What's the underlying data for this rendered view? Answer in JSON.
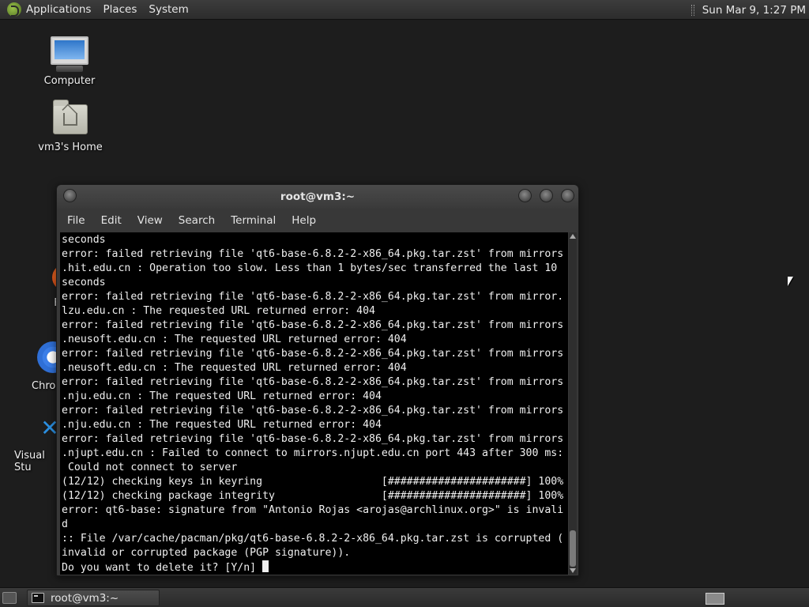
{
  "top_panel": {
    "menus": [
      "Applications",
      "Places",
      "System"
    ],
    "clock": "Sun Mar  9,  1:27 PM"
  },
  "desktop_icons": [
    {
      "label": "Computer",
      "icon": "computer-icon"
    },
    {
      "label": "vm3's Home",
      "icon": "home-folder-icon"
    },
    {
      "label": "F",
      "icon": "firefox-icon"
    },
    {
      "label": "Chron",
      "icon": "chromium-icon"
    },
    {
      "label": "Visual Stu",
      "icon": "vscode-icon"
    }
  ],
  "window": {
    "title": "root@vm3:~",
    "menu": [
      "File",
      "Edit",
      "View",
      "Search",
      "Terminal",
      "Help"
    ]
  },
  "terminal": {
    "lines": [
      "seconds",
      "error: failed retrieving file 'qt6-base-6.8.2-2-x86_64.pkg.tar.zst' from mirrors",
      ".hit.edu.cn : Operation too slow. Less than 1 bytes/sec transferred the last 10",
      "seconds",
      "error: failed retrieving file 'qt6-base-6.8.2-2-x86_64.pkg.tar.zst' from mirror.",
      "lzu.edu.cn : The requested URL returned error: 404",
      "error: failed retrieving file 'qt6-base-6.8.2-2-x86_64.pkg.tar.zst' from mirrors",
      ".neusoft.edu.cn : The requested URL returned error: 404",
      "error: failed retrieving file 'qt6-base-6.8.2-2-x86_64.pkg.tar.zst' from mirrors",
      ".neusoft.edu.cn : The requested URL returned error: 404",
      "error: failed retrieving file 'qt6-base-6.8.2-2-x86_64.pkg.tar.zst' from mirrors",
      ".nju.edu.cn : The requested URL returned error: 404",
      "error: failed retrieving file 'qt6-base-6.8.2-2-x86_64.pkg.tar.zst' from mirrors",
      ".nju.edu.cn : The requested URL returned error: 404",
      "error: failed retrieving file 'qt6-base-6.8.2-2-x86_64.pkg.tar.zst' from mirrors",
      ".njupt.edu.cn : Failed to connect to mirrors.njupt.edu.cn port 443 after 300 ms:",
      " Could not connect to server",
      "(12/12) checking keys in keyring                   [######################] 100%",
      "(12/12) checking package integrity                 [######################] 100%",
      "error: qt6-base: signature from \"Antonio Rojas <arojas@archlinux.org>\" is invali",
      "d",
      ":: File /var/cache/pacman/pkg/qt6-base-6.8.2-2-x86_64.pkg.tar.zst is corrupted (",
      "invalid or corrupted package (PGP signature)).",
      "Do you want to delete it? [Y/n] "
    ]
  },
  "taskbar": {
    "task_label": "root@vm3:~"
  }
}
